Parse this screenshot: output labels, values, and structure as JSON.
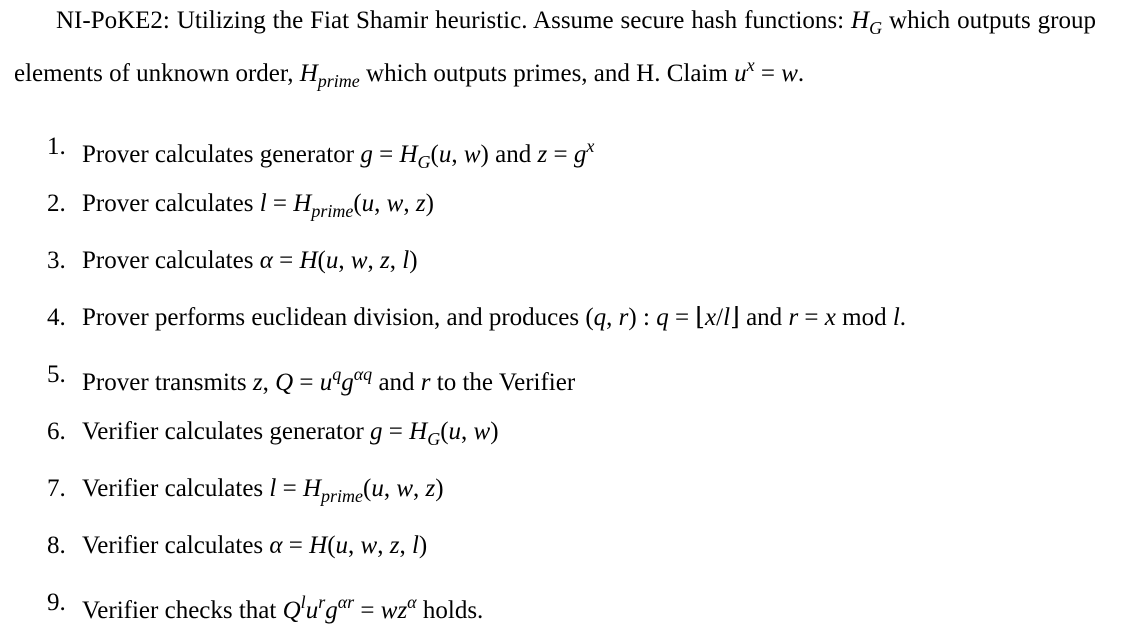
{
  "intro": [
    [
      "t",
      "NI-PoKE2: Utilizing the Fiat Shamir heuristic.  Assume secure hash functions: "
    ],
    [
      "i",
      "H"
    ],
    [
      "b",
      "G"
    ],
    [
      "t",
      " which outputs group elements of unknown order, "
    ],
    [
      "i",
      "H"
    ],
    [
      "b",
      "prime"
    ],
    [
      "t",
      " which outputs primes, and H. Claim "
    ],
    [
      "i",
      "u"
    ],
    [
      "p",
      "x"
    ],
    [
      "r",
      " = "
    ],
    [
      "i",
      "w"
    ],
    [
      "r",
      "."
    ]
  ],
  "items": [
    {
      "num": "1.",
      "segments": [
        [
          "t",
          "Prover calculates generator "
        ],
        [
          "i",
          "g"
        ],
        [
          "r",
          " = "
        ],
        [
          "i",
          "H"
        ],
        [
          "b",
          "G"
        ],
        [
          "r",
          "("
        ],
        [
          "i",
          "u"
        ],
        [
          "r",
          ", "
        ],
        [
          "i",
          "w"
        ],
        [
          "r",
          ")"
        ],
        [
          "t",
          " and "
        ],
        [
          "i",
          "z"
        ],
        [
          "r",
          " = "
        ],
        [
          "i",
          "g"
        ],
        [
          "p",
          "x"
        ]
      ]
    },
    {
      "num": "2.",
      "segments": [
        [
          "t",
          "Prover calculates "
        ],
        [
          "i",
          "l"
        ],
        [
          "r",
          " = "
        ],
        [
          "i",
          "H"
        ],
        [
          "b",
          "prime"
        ],
        [
          "r",
          "("
        ],
        [
          "i",
          "u"
        ],
        [
          "r",
          ", "
        ],
        [
          "i",
          "w"
        ],
        [
          "r",
          ", "
        ],
        [
          "i",
          "z"
        ],
        [
          "r",
          ")"
        ]
      ]
    },
    {
      "num": "3.",
      "segments": [
        [
          "t",
          "Prover calculates "
        ],
        [
          "i",
          "α"
        ],
        [
          "r",
          " = "
        ],
        [
          "i",
          "H"
        ],
        [
          "r",
          "("
        ],
        [
          "i",
          "u"
        ],
        [
          "r",
          ", "
        ],
        [
          "i",
          "w"
        ],
        [
          "r",
          ", "
        ],
        [
          "i",
          "z"
        ],
        [
          "r",
          ", "
        ],
        [
          "i",
          "l"
        ],
        [
          "r",
          ")"
        ]
      ]
    },
    {
      "num": "4.",
      "segments": [
        [
          "t",
          "Prover performs euclidean division, and produces "
        ],
        [
          "r",
          "("
        ],
        [
          "i",
          "q"
        ],
        [
          "r",
          ", "
        ],
        [
          "i",
          "r"
        ],
        [
          "r",
          ") : "
        ],
        [
          "i",
          "q"
        ],
        [
          "r",
          " = ⌊"
        ],
        [
          "i",
          "x"
        ],
        [
          "r",
          "/"
        ],
        [
          "i",
          "l"
        ],
        [
          "r",
          "⌋"
        ],
        [
          "t",
          " and "
        ],
        [
          "i",
          "r"
        ],
        [
          "r",
          " = "
        ],
        [
          "i",
          "x"
        ],
        [
          "r",
          "  mod "
        ],
        [
          "i",
          "l"
        ],
        [
          "r",
          "."
        ]
      ]
    },
    {
      "num": "5.",
      "segments": [
        [
          "t",
          "Prover transmits "
        ],
        [
          "i",
          "z"
        ],
        [
          "r",
          ", "
        ],
        [
          "i",
          "Q"
        ],
        [
          "r",
          " = "
        ],
        [
          "i",
          "u"
        ],
        [
          "p",
          "q"
        ],
        [
          "i",
          "g"
        ],
        [
          "p",
          "αq"
        ],
        [
          "t",
          " and "
        ],
        [
          "i",
          "r"
        ],
        [
          "t",
          " to the Verifier"
        ]
      ]
    },
    {
      "num": "6.",
      "segments": [
        [
          "t",
          "Verifier calculates generator "
        ],
        [
          "i",
          "g"
        ],
        [
          "r",
          " = "
        ],
        [
          "i",
          "H"
        ],
        [
          "b",
          "G"
        ],
        [
          "r",
          "("
        ],
        [
          "i",
          "u"
        ],
        [
          "r",
          ", "
        ],
        [
          "i",
          "w"
        ],
        [
          "r",
          ")"
        ]
      ]
    },
    {
      "num": "7.",
      "segments": [
        [
          "t",
          "Verifier calculates "
        ],
        [
          "i",
          "l"
        ],
        [
          "r",
          " = "
        ],
        [
          "i",
          "H"
        ],
        [
          "b",
          "prime"
        ],
        [
          "r",
          "("
        ],
        [
          "i",
          "u"
        ],
        [
          "r",
          ", "
        ],
        [
          "i",
          "w"
        ],
        [
          "r",
          ", "
        ],
        [
          "i",
          "z"
        ],
        [
          "r",
          ")"
        ]
      ]
    },
    {
      "num": "8.",
      "segments": [
        [
          "t",
          "Verifier calculates "
        ],
        [
          "i",
          "α"
        ],
        [
          "r",
          " = "
        ],
        [
          "i",
          "H"
        ],
        [
          "r",
          "("
        ],
        [
          "i",
          "u"
        ],
        [
          "r",
          ", "
        ],
        [
          "i",
          "w"
        ],
        [
          "r",
          ", "
        ],
        [
          "i",
          "z"
        ],
        [
          "r",
          ", "
        ],
        [
          "i",
          "l"
        ],
        [
          "r",
          ")"
        ]
      ]
    },
    {
      "num": "9.",
      "segments": [
        [
          "t",
          "Verifier checks that "
        ],
        [
          "i",
          "Q"
        ],
        [
          "p",
          "l"
        ],
        [
          "i",
          "u"
        ],
        [
          "p",
          "r"
        ],
        [
          "i",
          "g"
        ],
        [
          "p",
          "αr"
        ],
        [
          "r",
          " = "
        ],
        [
          "i",
          "wz"
        ],
        [
          "p",
          "α"
        ],
        [
          "t",
          " holds."
        ]
      ]
    }
  ]
}
